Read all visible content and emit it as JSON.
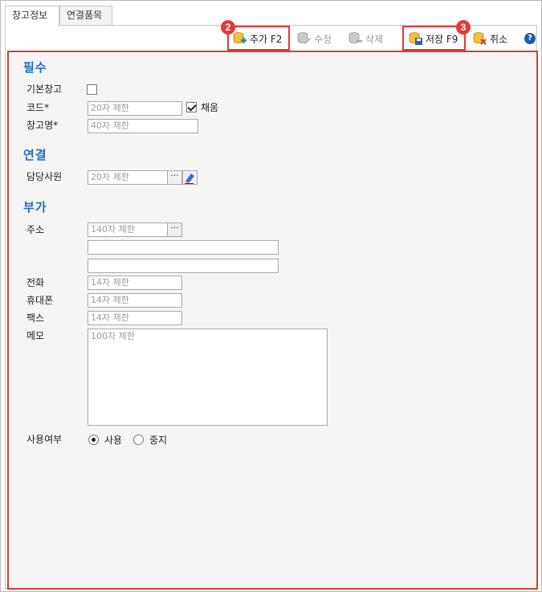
{
  "tabs": [
    {
      "label": "창고정보",
      "active": true
    },
    {
      "label": "연결품목",
      "active": false
    }
  ],
  "toolbar": {
    "add": {
      "label": "추가 F2",
      "badge": "2",
      "enabled": true
    },
    "edit": {
      "label": "수정",
      "enabled": false
    },
    "delete": {
      "label": "삭제",
      "enabled": false
    },
    "save": {
      "label": "저장 F9",
      "badge": "3",
      "enabled": true
    },
    "cancel": {
      "label": "취소",
      "enabled": true
    },
    "help": "?"
  },
  "sections": {
    "required": "필수",
    "link": "연결",
    "additional": "부가"
  },
  "fields": {
    "default_warehouse": {
      "label": "기본창고",
      "checked": false
    },
    "code": {
      "label": "코드*",
      "placeholder": "20자 제한",
      "auto_label": "채움",
      "auto_checked": true
    },
    "name": {
      "label": "창고명*",
      "placeholder": "40자 제한"
    },
    "manager": {
      "label": "담당사원",
      "placeholder": "20자 제한"
    },
    "address": {
      "label": "주소",
      "placeholder": "140자 제한"
    },
    "phone": {
      "label": "전화",
      "placeholder": "14자 제한"
    },
    "mobile": {
      "label": "휴대폰",
      "placeholder": "14자 제한"
    },
    "fax": {
      "label": "팩스",
      "placeholder": "14자 제한"
    },
    "memo": {
      "label": "메모",
      "placeholder": "100자 제한"
    },
    "usage": {
      "label": "사용여부",
      "options": [
        "사용",
        "중지"
      ],
      "selected": "사용"
    }
  },
  "colors": {
    "highlight": "#e0393b",
    "section": "#1f6fc0",
    "help": "#1f5aa6"
  }
}
